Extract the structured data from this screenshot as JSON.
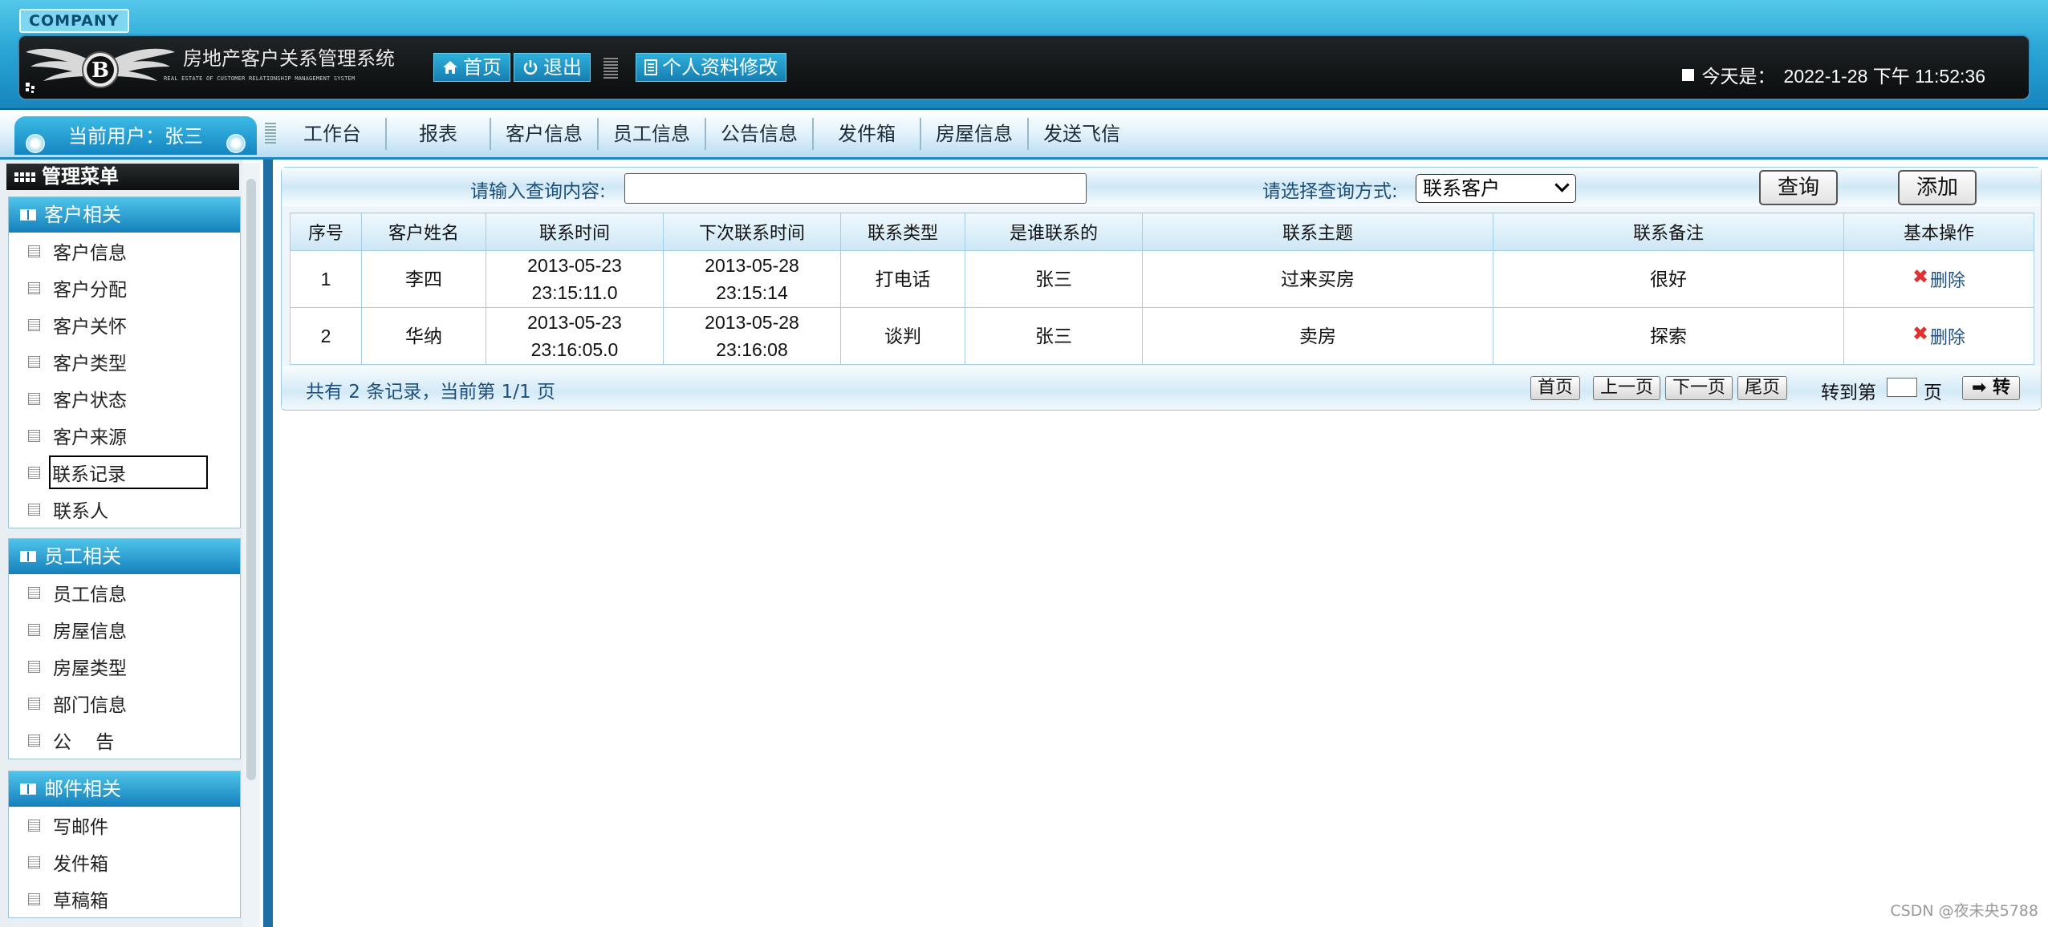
{
  "header": {
    "company": "COMPANY",
    "title": "房地产客户关系管理系统",
    "subtitle": "REAL ESTATE OF CUSTOMER RELATIONSHIP MANAGEMENT SYSTEM",
    "home_label": "首页",
    "logout_label": "退出",
    "profile_label": "个人资料修改",
    "date_label": "今天是：",
    "date_value": "2022-1-28 下午 11:52:36"
  },
  "nav": {
    "current_user": "当前用户：张三",
    "items": [
      "工作台",
      "报表",
      "客户信息",
      "员工信息",
      "公告信息",
      "发件箱",
      "房屋信息",
      "发送飞信"
    ]
  },
  "sidebar": {
    "title": "管理菜单",
    "groups": [
      {
        "title": "客户相关",
        "items": [
          "客户信息",
          "客户分配",
          "客户关怀",
          "客户类型",
          "客户状态",
          "客户来源",
          "联系记录",
          "联系人"
        ]
      },
      {
        "title": "员工相关",
        "items": [
          "员工信息",
          "房屋信息",
          "房屋类型",
          "部门信息",
          "公　 告"
        ]
      },
      {
        "title": "邮件相关",
        "items": [
          "写邮件",
          "发件箱",
          "草稿箱"
        ]
      }
    ],
    "active_item": "联系记录"
  },
  "search": {
    "label": "请输入查询内容:",
    "value": "",
    "mode_label": "请选择查询方式:",
    "mode_value": "联系客户",
    "query_button": "查询",
    "add_button": "添加"
  },
  "table": {
    "columns": [
      "序号",
      "客户姓名",
      "联系时间",
      "下次联系时间",
      "联系类型",
      "是谁联系的",
      "联系主题",
      "联系备注",
      "基本操作"
    ],
    "rows": [
      {
        "no": "1",
        "name": "李四",
        "time_date": "2013-05-23",
        "time_clock": "23:15:11.0",
        "next_date": "2013-05-28",
        "next_clock": "23:15:14",
        "type": "打电话",
        "by": "张三",
        "subject": "过来买房",
        "note": "很好",
        "action": "删除"
      },
      {
        "no": "2",
        "name": "华纳",
        "time_date": "2013-05-23",
        "time_clock": "23:16:05.0",
        "next_date": "2013-05-28",
        "next_clock": "23:16:08",
        "type": "谈判",
        "by": "张三",
        "subject": "卖房",
        "note": "探索",
        "action": "删除"
      }
    ]
  },
  "pager": {
    "info": "共有 2 条记录，当前第 1/1 页",
    "first": "首页",
    "prev": "上一页",
    "next": "下一页",
    "last": "尾页",
    "goto_label": "转到第",
    "page_unit": "页",
    "goto_button": "➡ 转"
  },
  "watermark": "CSDN @夜未央5788",
  "colors": {
    "accent": "#1e88c0",
    "header_dark": "#0b0d0e",
    "link": "#1b4f86",
    "delete_icon": "#e03030"
  }
}
